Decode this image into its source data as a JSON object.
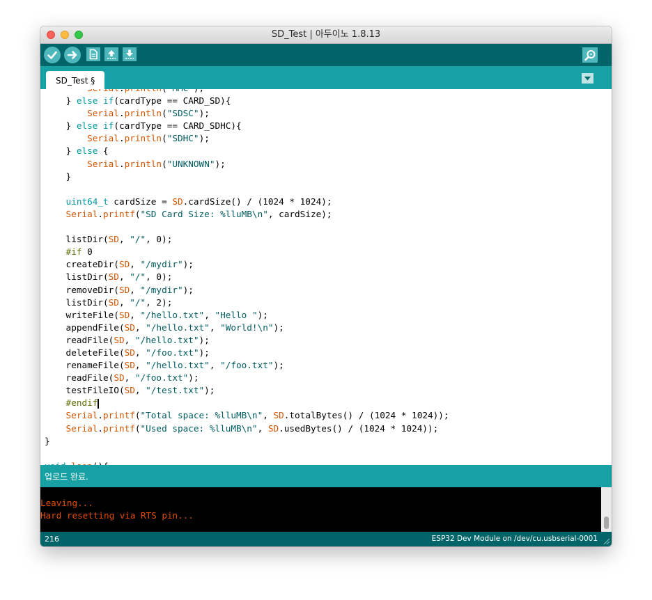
{
  "window": {
    "title": "SD_Test | 아두이노 1.8.13"
  },
  "toolbar": {
    "buttons": [
      {
        "name": "verify",
        "icon": "check-icon"
      },
      {
        "name": "upload",
        "icon": "arrow-right-icon"
      },
      {
        "name": "new",
        "icon": "new-file-icon"
      },
      {
        "name": "open",
        "icon": "arrow-up-icon"
      },
      {
        "name": "save",
        "icon": "arrow-down-icon"
      }
    ],
    "serial_monitor_icon": "magnifier-icon"
  },
  "tabs": [
    {
      "label": "SD_Test §"
    }
  ],
  "editor": {
    "lines": [
      [
        [
          "fn",
          "        Serial"
        ],
        [
          "",
          "."
        ],
        [
          "fn",
          "println"
        ],
        [
          "",
          "("
        ],
        [
          "str",
          "\"MMC\""
        ],
        [
          "",
          ");"
        ]
      ],
      [
        [
          "",
          "    } "
        ],
        [
          "kw",
          "else"
        ],
        [
          "",
          ""
        ],
        [
          "kw",
          " if"
        ],
        [
          "",
          "(cardType == CARD_SD){"
        ]
      ],
      [
        [
          "fn",
          "        Serial"
        ],
        [
          "",
          "."
        ],
        [
          "fn",
          "println"
        ],
        [
          "",
          "("
        ],
        [
          "str",
          "\"SDSC\""
        ],
        [
          "",
          ");"
        ]
      ],
      [
        [
          "",
          "    } "
        ],
        [
          "kw",
          "else"
        ],
        [
          "kw",
          " if"
        ],
        [
          "",
          "(cardType == CARD_SDHC){"
        ]
      ],
      [
        [
          "fn",
          "        Serial"
        ],
        [
          "",
          "."
        ],
        [
          "fn",
          "println"
        ],
        [
          "",
          "("
        ],
        [
          "str",
          "\"SDHC\""
        ],
        [
          "",
          ");"
        ]
      ],
      [
        [
          "",
          "    } "
        ],
        [
          "kw",
          "else"
        ],
        [
          "",
          " {"
        ]
      ],
      [
        [
          "fn",
          "        Serial"
        ],
        [
          "",
          "."
        ],
        [
          "fn",
          "println"
        ],
        [
          "",
          "("
        ],
        [
          "str",
          "\"UNKNOWN\""
        ],
        [
          "",
          ");"
        ]
      ],
      [
        [
          "",
          "    }"
        ]
      ],
      [
        [
          "",
          ""
        ]
      ],
      [
        [
          "kw",
          "    uint64_t"
        ],
        [
          "",
          " cardSize = "
        ],
        [
          "fn",
          "SD"
        ],
        [
          "",
          ".cardSize() / (1024 * 1024);"
        ]
      ],
      [
        [
          "fn",
          "    Serial"
        ],
        [
          "",
          "."
        ],
        [
          "fn",
          "printf"
        ],
        [
          "",
          "("
        ],
        [
          "str",
          "\"SD Card Size: %lluMB\\n\""
        ],
        [
          "",
          ", cardSize);"
        ]
      ],
      [
        [
          "",
          ""
        ]
      ],
      [
        [
          "",
          "    listDir("
        ],
        [
          "fn",
          "SD"
        ],
        [
          "",
          ", "
        ],
        [
          "str",
          "\"/\""
        ],
        [
          "",
          ", 0);"
        ]
      ],
      [
        [
          "dir",
          "    #if"
        ],
        [
          "",
          " 0"
        ]
      ],
      [
        [
          "",
          "    createDir("
        ],
        [
          "fn",
          "SD"
        ],
        [
          "",
          ", "
        ],
        [
          "str",
          "\"/mydir\""
        ],
        [
          "",
          ");"
        ]
      ],
      [
        [
          "",
          "    listDir("
        ],
        [
          "fn",
          "SD"
        ],
        [
          "",
          ", "
        ],
        [
          "str",
          "\"/\""
        ],
        [
          "",
          ", 0);"
        ]
      ],
      [
        [
          "",
          "    removeDir("
        ],
        [
          "fn",
          "SD"
        ],
        [
          "",
          ", "
        ],
        [
          "str",
          "\"/mydir\""
        ],
        [
          "",
          ");"
        ]
      ],
      [
        [
          "",
          "    listDir("
        ],
        [
          "fn",
          "SD"
        ],
        [
          "",
          ", "
        ],
        [
          "str",
          "\"/\""
        ],
        [
          "",
          ", 2);"
        ]
      ],
      [
        [
          "",
          "    writeFile("
        ],
        [
          "fn",
          "SD"
        ],
        [
          "",
          ", "
        ],
        [
          "str",
          "\"/hello.txt\""
        ],
        [
          "",
          ", "
        ],
        [
          "str",
          "\"Hello \""
        ],
        [
          "",
          ");"
        ]
      ],
      [
        [
          "",
          "    appendFile("
        ],
        [
          "fn",
          "SD"
        ],
        [
          "",
          ", "
        ],
        [
          "str",
          "\"/hello.txt\""
        ],
        [
          "",
          ", "
        ],
        [
          "str",
          "\"World!\\n\""
        ],
        [
          "",
          ");"
        ]
      ],
      [
        [
          "",
          "    readFile("
        ],
        [
          "fn",
          "SD"
        ],
        [
          "",
          ", "
        ],
        [
          "str",
          "\"/hello.txt\""
        ],
        [
          "",
          ");"
        ]
      ],
      [
        [
          "",
          "    deleteFile("
        ],
        [
          "fn",
          "SD"
        ],
        [
          "",
          ", "
        ],
        [
          "str",
          "\"/foo.txt\""
        ],
        [
          "",
          ");"
        ]
      ],
      [
        [
          "",
          "    renameFile("
        ],
        [
          "fn",
          "SD"
        ],
        [
          "",
          ", "
        ],
        [
          "str",
          "\"/hello.txt\""
        ],
        [
          "",
          ", "
        ],
        [
          "str",
          "\"/foo.txt\""
        ],
        [
          "",
          ");"
        ]
      ],
      [
        [
          "",
          "    readFile("
        ],
        [
          "fn",
          "SD"
        ],
        [
          "",
          ", "
        ],
        [
          "str",
          "\"/foo.txt\""
        ],
        [
          "",
          ");"
        ]
      ],
      [
        [
          "",
          "    testFileIO("
        ],
        [
          "fn",
          "SD"
        ],
        [
          "",
          ", "
        ],
        [
          "str",
          "\"/test.txt\""
        ],
        [
          "",
          ");"
        ]
      ],
      [
        [
          "dir",
          "    #endif"
        ],
        [
          "cursor",
          ""
        ]
      ],
      [
        [
          "fn",
          "    Serial"
        ],
        [
          "",
          "."
        ],
        [
          "fn",
          "printf"
        ],
        [
          "",
          "("
        ],
        [
          "str",
          "\"Total space: %lluMB\\n\""
        ],
        [
          "",
          ", "
        ],
        [
          "fn",
          "SD"
        ],
        [
          "",
          ".totalBytes() / (1024 * 1024));"
        ]
      ],
      [
        [
          "fn",
          "    Serial"
        ],
        [
          "",
          "."
        ],
        [
          "fn",
          "printf"
        ],
        [
          "",
          "("
        ],
        [
          "str",
          "\"Used space: %lluMB\\n\""
        ],
        [
          "",
          ", "
        ],
        [
          "fn",
          "SD"
        ],
        [
          "",
          ".usedBytes() / (1024 * 1024));"
        ]
      ],
      [
        [
          "",
          "}"
        ]
      ],
      [
        [
          "",
          ""
        ]
      ],
      [
        [
          "kw",
          "void"
        ],
        [
          "",
          " "
        ],
        [
          "fn",
          "loop"
        ],
        [
          "",
          "(){"
        ]
      ]
    ]
  },
  "status": {
    "message": "업로드 완료."
  },
  "console": {
    "lines": [
      "Leaving...",
      "Hard resetting via RTS pin..."
    ]
  },
  "footer": {
    "line_number": "216",
    "board": "ESP32 Dev Module on /dev/cu.usbserial-0001"
  }
}
